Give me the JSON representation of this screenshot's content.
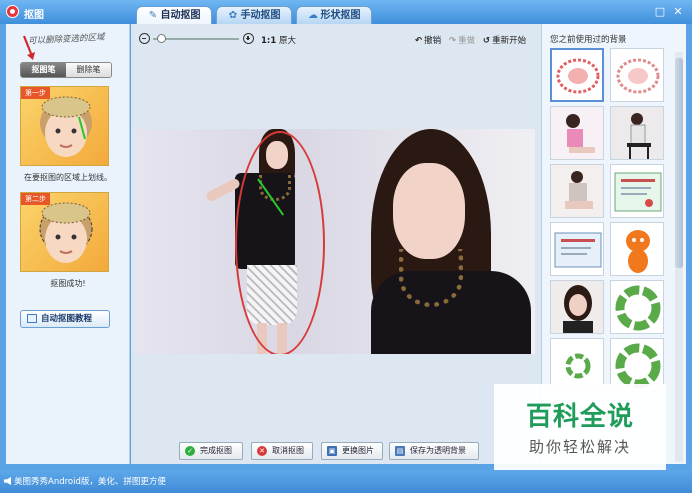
{
  "window": {
    "title": "抠图",
    "tabs": [
      {
        "label": "自动抠图",
        "icon": "brush-icon",
        "active": true
      },
      {
        "label": "手动抠图",
        "icon": "gear-icon",
        "active": false
      },
      {
        "label": "形状抠图",
        "icon": "shape-icon",
        "active": false
      }
    ],
    "controls": {
      "restore": "□",
      "close": "✕"
    }
  },
  "left_panel": {
    "hint": "可以删除变选的区域",
    "buttons": {
      "cutout_pen": "抠图笔",
      "eraser_pen": "删除笔"
    },
    "step1": {
      "badge": "第一步",
      "caption": "在要抠图的区域上划线。"
    },
    "step2": {
      "badge": "第二步",
      "caption": "抠图成功!"
    },
    "tutorial_button": "自动抠图教程"
  },
  "toolbar": {
    "zoom_ratio": "1:1",
    "zoom_label": "原大",
    "undo": "撤销",
    "redo": "重做",
    "restart": "重新开始",
    "zoom_level": 0.05
  },
  "actions": {
    "finish": "完成抠图",
    "cancel": "取消抠图",
    "change_image": "更换图片",
    "save_transparent": "保存为透明背景"
  },
  "right_panel": {
    "title": "您之前使用过的背景",
    "thumbnails": [
      "red-pattern",
      "red-pattern-2",
      "woman-pink",
      "woman-chair",
      "woman-sitting",
      "certificate",
      "certificate-2",
      "orange-mascot",
      "woman-portrait",
      "green-ring",
      "green-ring-small",
      "green-ring-2"
    ]
  },
  "watermark": {
    "main": "百科全说",
    "sub": "助你轻松解决"
  },
  "status": {
    "text": "美图秀秀Android版，美化、拼图更方便"
  },
  "colors": {
    "accent": "#3f8fdc",
    "selection": "#d83a3a",
    "stroke": "#28c828",
    "watermark": "#1f9c5a"
  }
}
